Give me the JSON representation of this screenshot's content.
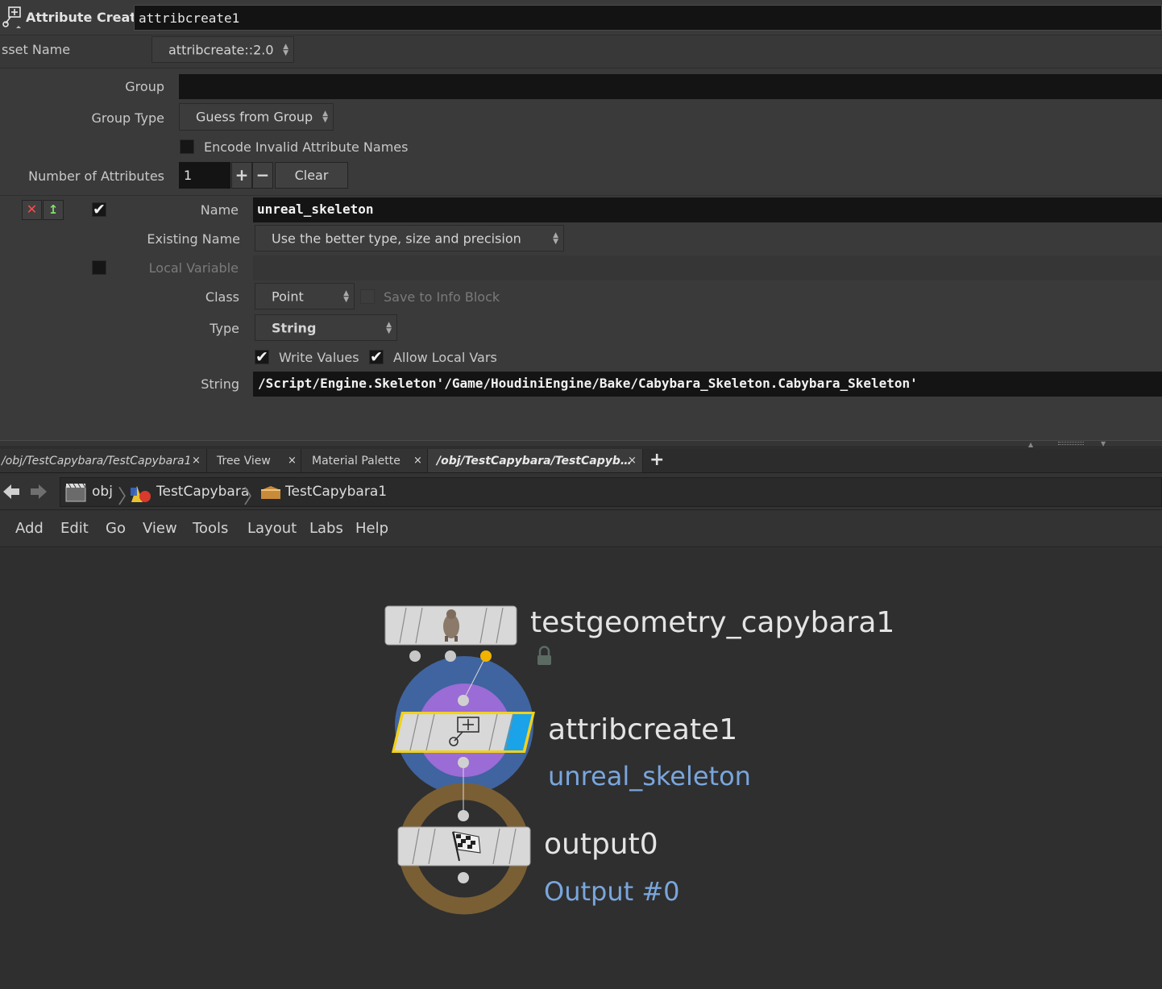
{
  "header": {
    "node_type": "Attribute Create",
    "node_name": "attribcreate1",
    "asset_name_label": "sset Name",
    "asset_name_value": "attribcreate::2.0"
  },
  "params": {
    "group_label": "Group",
    "group_value": "",
    "group_type_label": "Group Type",
    "group_type_value": "Guess from Group",
    "encode_label": "Encode Invalid Attribute Names",
    "num_attribs_label": "Number of Attributes",
    "num_attribs_value": "1",
    "plus": "+",
    "minus": "−",
    "clear_label": "Clear",
    "name_label": "Name",
    "name_value": "unreal_skeleton",
    "existing_name_label": "Existing Name",
    "existing_name_value": "Use the better type, size and precision",
    "local_variable_label": "Local Variable",
    "class_label": "Class",
    "class_value": "Point",
    "save_info_label": "Save to Info Block",
    "type_label": "Type",
    "type_value": "String",
    "write_values_label": "Write Values",
    "allow_local_vars_label": "Allow Local Vars",
    "string_label": "String",
    "string_value": "/Script/Engine.Skeleton'/Game/HoudiniEngine/Bake/Cabybara_Skeleton.Cabybara_Skeleton'"
  },
  "tabs": [
    {
      "label": "/obj/TestCapybara/TestCapybara1"
    },
    {
      "label": "Tree View"
    },
    {
      "label": "Material Palette"
    },
    {
      "label": "/obj/TestCapybara/TestCapyb…"
    }
  ],
  "tab_add": "+",
  "tab_close": "×",
  "breadcrumb": [
    "obj",
    "TestCapybara",
    "TestCapybara1"
  ],
  "menu": [
    "Add",
    "Edit",
    "Go",
    "View",
    "Tools",
    "Layout",
    "Labs",
    "Help"
  ],
  "nodes": {
    "n1_name": "testgeometry_capybara1",
    "n2_name": "attribcreate1",
    "n2_sub": "unreal_skeleton",
    "n3_name": "output0",
    "n3_sub": "Output #0"
  },
  "colors": {
    "selected_outline": "#f2d11a",
    "display_flag": "#1aa3e8",
    "ring_blue": "#3f64a0",
    "ring_purple": "#9b6bd6",
    "ring_brown": "#7a5f35",
    "sub_text": "#79a6dd"
  }
}
